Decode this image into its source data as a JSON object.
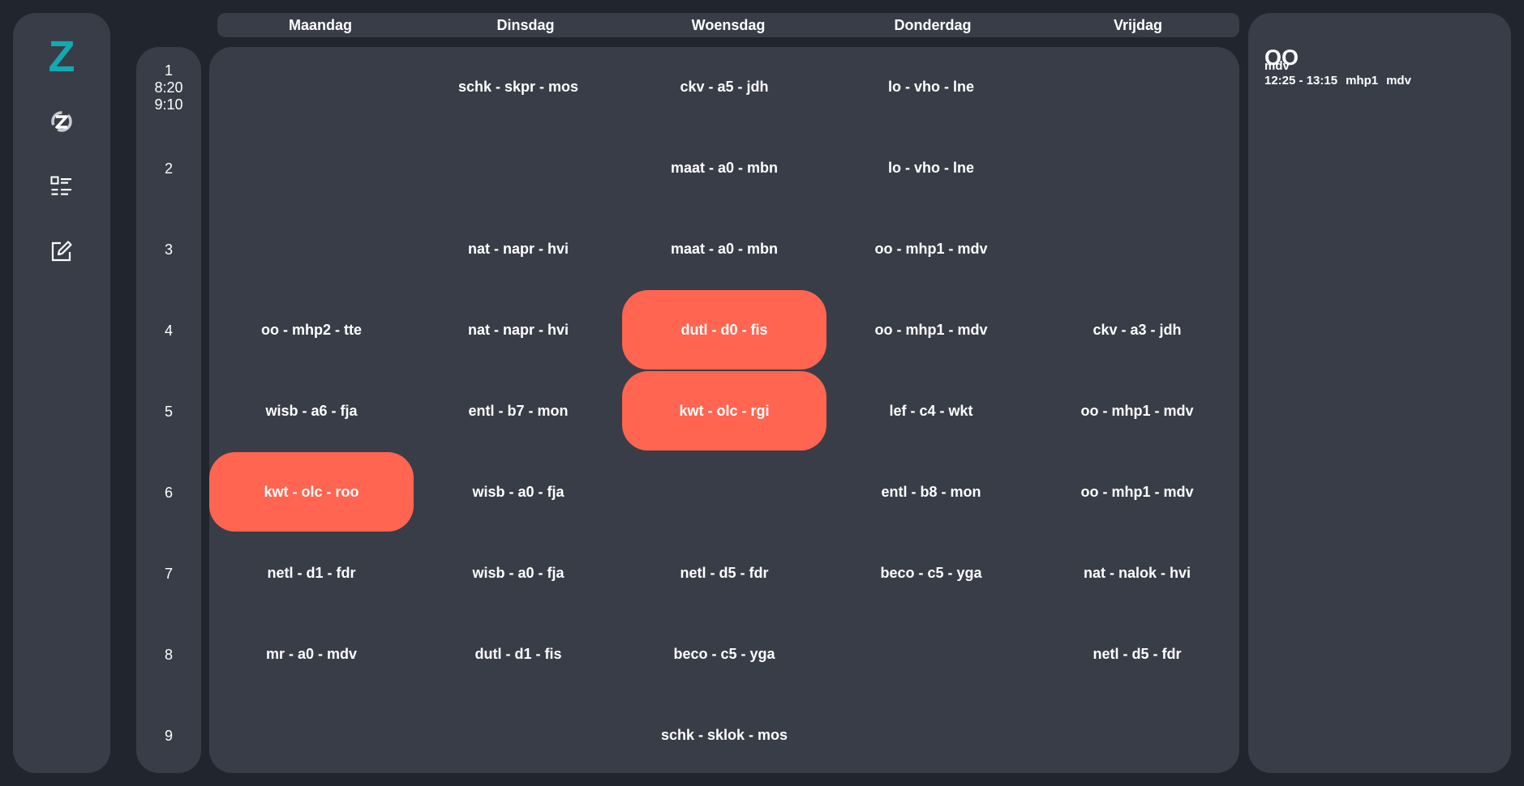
{
  "sidebar": {
    "logo": "Z",
    "items": [
      {
        "icon": "refresh-logo-icon"
      },
      {
        "icon": "list-icon"
      },
      {
        "icon": "edit-icon"
      }
    ]
  },
  "days": [
    "Maandag",
    "Dinsdag",
    "Woensdag",
    "Donderdag",
    "Vrijdag"
  ],
  "hours": [
    {
      "num": "1",
      "start": "8:20",
      "end": "9:10"
    },
    {
      "num": "2"
    },
    {
      "num": "3"
    },
    {
      "num": "4"
    },
    {
      "num": "5"
    },
    {
      "num": "6"
    },
    {
      "num": "7"
    },
    {
      "num": "8"
    },
    {
      "num": "9"
    }
  ],
  "schedule": [
    [
      "",
      "schk - skpr - mos",
      "ckv - a5 - jdh",
      "lo - vho - lne",
      ""
    ],
    [
      "",
      "",
      "maat - a0 - mbn",
      "lo - vho - lne",
      ""
    ],
    [
      "",
      "nat - napr - hvi",
      "maat - a0 - mbn",
      "oo - mhp1 - mdv",
      ""
    ],
    [
      "oo - mhp2 - tte",
      "nat - napr - hvi",
      "dutl - d0 - fis",
      "oo - mhp1 - mdv",
      "ckv - a3 - jdh"
    ],
    [
      "wisb - a6 - fja",
      "entl - b7 - mon",
      "kwt - olc - rgi",
      "lef - c4 - wkt",
      "oo - mhp1 - mdv"
    ],
    [
      "kwt - olc - roo",
      "wisb - a0 - fja",
      "",
      "entl - b8 - mon",
      "oo - mhp1 - mdv"
    ],
    [
      "netl - d1 - fdr",
      "wisb - a0 - fja",
      "netl - d5 - fdr",
      "beco - c5 - yga",
      "nat - nalok - hvi"
    ],
    [
      "mr - a0 - mdv",
      "dutl - d1 - fis",
      "beco - c5 - yga",
      "",
      "netl - d5 - fdr"
    ],
    [
      "",
      "",
      "schk - sklok - mos",
      "",
      ""
    ]
  ],
  "highlighted": [
    [
      3,
      2
    ],
    [
      4,
      2
    ],
    [
      5,
      0
    ]
  ],
  "highlight_color": "#ff6550",
  "accent_color": "#13a8b2",
  "detail": {
    "title": "OO",
    "teacher": "mdv",
    "time": "12:25 - 13:15",
    "room": "mhp1",
    "teacher2": "mdv"
  }
}
